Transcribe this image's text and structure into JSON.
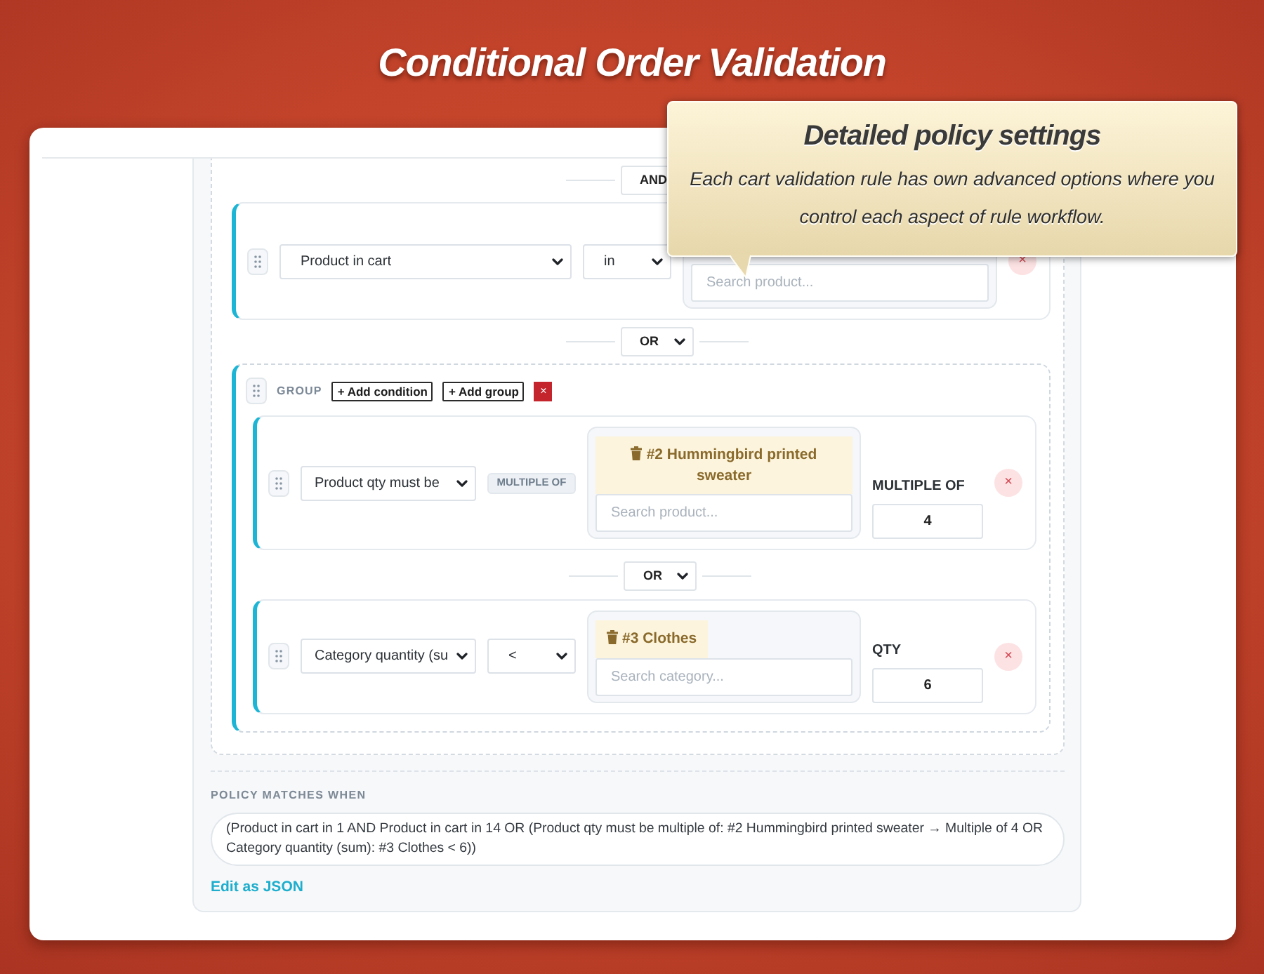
{
  "title": "Conditional Order Validation",
  "callout": {
    "title": "Detailed policy settings",
    "text": "Each cart validation rule has own advanced options where you control each aspect of rule workflow."
  },
  "rules": [
    {
      "kind": "connector",
      "operator": "AND"
    },
    {
      "kind": "condition",
      "field": "Product in cart",
      "operator": {
        "kind": "select",
        "text": "in"
      },
      "value": {
        "placeholder": "Search product..."
      },
      "remove": "×"
    },
    {
      "kind": "connector",
      "operator": "OR"
    },
    {
      "kind": "group",
      "label": "GROUP",
      "actions": [
        "+ Add condition",
        "+ Add group"
      ],
      "remove": "×",
      "items": [
        {
          "kind": "condition",
          "field": "Product qty must be",
          "operator": {
            "kind": "badge",
            "text": "MULTIPLE OF"
          },
          "value": {
            "tags": [
              "#2 Hummingbird printed sweater"
            ],
            "placeholder": "Search product..."
          },
          "amount": {
            "label": "MULTIPLE OF",
            "value": "4"
          },
          "remove": "×"
        },
        {
          "kind": "connector",
          "operator": "OR"
        },
        {
          "kind": "condition",
          "field": "Category quantity (su",
          "operator": {
            "kind": "select",
            "text": "<"
          },
          "value": {
            "tags": [
              "#3 Clothes"
            ],
            "placeholder": "Search category..."
          },
          "amount": {
            "label": "QTY",
            "value": "6"
          },
          "remove": "×"
        }
      ]
    }
  ],
  "summary": {
    "label": "POLICY MATCHES WHEN",
    "text": "(Product in cart in 1 AND Product in cart in 14 OR (Product qty must be multiple of: #2 Hummingbird printed sweater → Multiple of 4 OR Category quantity (sum): #3 Clothes < 6))",
    "link": "Edit as JSON"
  }
}
